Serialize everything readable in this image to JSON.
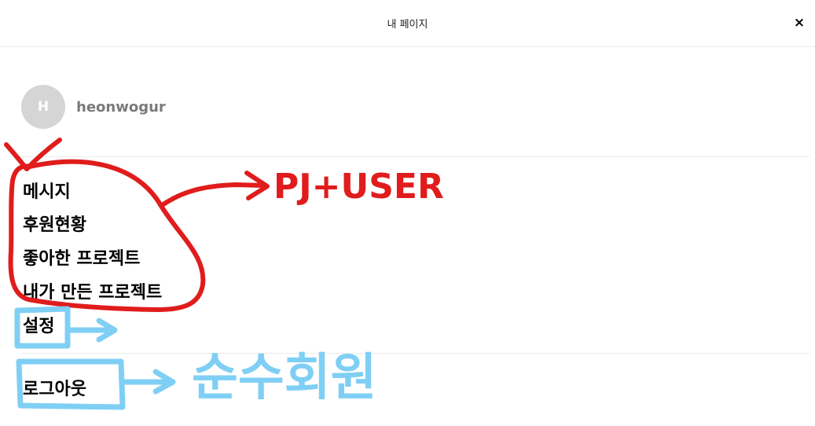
{
  "header": {
    "title": "내 페이지",
    "close_label": "×"
  },
  "profile": {
    "avatar_letter": "H",
    "username": "heonwogur"
  },
  "menu": {
    "messages": "메시지",
    "sponsorship_status": "후원현황",
    "liked_projects": "좋아한 프로젝트",
    "my_projects": "내가 만든 프로젝트",
    "settings": "설정",
    "logout": "로그아웃"
  },
  "annotations": {
    "red_note": "PJ+USER",
    "blue_note": "순수회원",
    "colors": {
      "red": "#e01c1c",
      "blue": "#7fcff5"
    }
  }
}
